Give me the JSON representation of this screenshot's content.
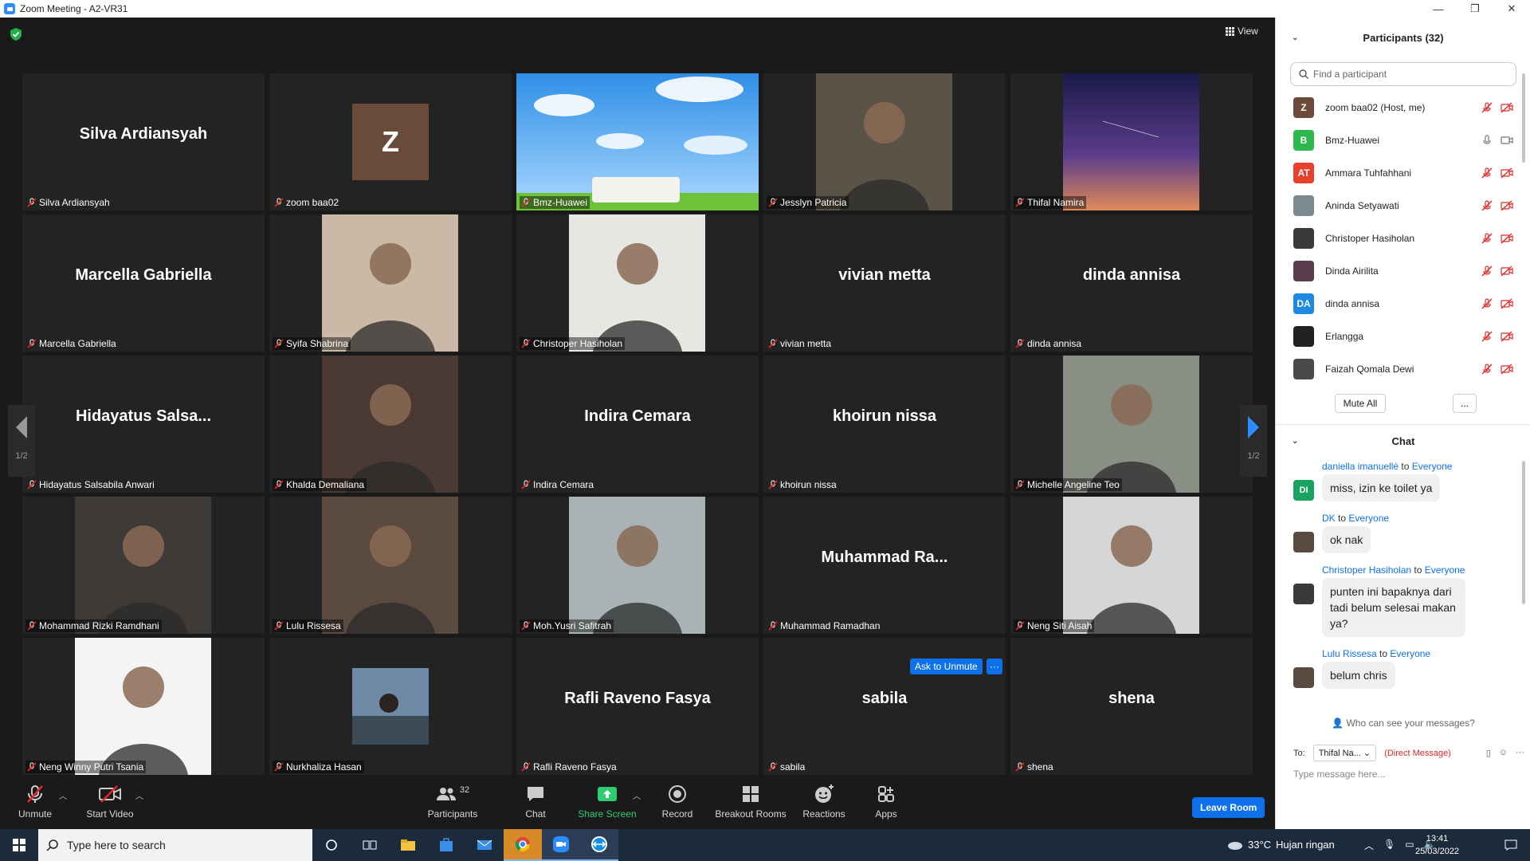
{
  "window": {
    "title": "Zoom Meeting - A2-VR31"
  },
  "view_label": "View",
  "tiles": [
    {
      "name": "Silva Ardiansyah",
      "display": "Silva Ardiansyah",
      "kind": "name"
    },
    {
      "name": "zoom baa02",
      "initial": "Z",
      "kind": "avatar"
    },
    {
      "name": "Bmz-Huawei",
      "kind": "sky"
    },
    {
      "name": "Jesslyn Patricia",
      "kind": "photo",
      "color": "#5a5448"
    },
    {
      "name": "Thifal Namira",
      "kind": "galaxy"
    },
    {
      "name": "Marcella Gabriella",
      "display": "Marcella Gabriella",
      "kind": "name"
    },
    {
      "name": "Syifa Shabrina",
      "kind": "photo",
      "color": "#c9b9a6"
    },
    {
      "name": "Christoper Hasiholan",
      "kind": "photo",
      "color": "#e6e6e2"
    },
    {
      "name": "vivian metta",
      "display": "vivian metta",
      "kind": "name"
    },
    {
      "name": "dinda annisa",
      "display": "dinda annisa",
      "kind": "name"
    },
    {
      "name": "Hidayatus Salsabila Anwari",
      "display": "Hidayatus  Salsa...",
      "kind": "name"
    },
    {
      "name": "Khalda Demaliana",
      "kind": "photo",
      "color": "#4a3a33"
    },
    {
      "name": "Indira Cemara",
      "display": "Indira Cemara",
      "kind": "name"
    },
    {
      "name": "khoirun nissa",
      "display": "khoirun nissa",
      "kind": "name"
    },
    {
      "name": "Michelle Angeline Teo",
      "kind": "photo",
      "color": "#8a8f86"
    },
    {
      "name": "Mohammad Rizki Ramdhani",
      "kind": "photo",
      "color": "#3d3a37"
    },
    {
      "name": "Lulu Rissesa",
      "kind": "photo",
      "color": "#5b4a40"
    },
    {
      "name": "Moh.Yusri Safitrah",
      "kind": "photo",
      "color": "#a9b2b4"
    },
    {
      "name": "Muhammad Ramadhan",
      "display": "Muhammad  Ra...",
      "kind": "name"
    },
    {
      "name": "Neng Siti Aisah",
      "kind": "photo",
      "color": "#d4d6d8"
    },
    {
      "name": "Neng Winny Putri Tsania",
      "kind": "photo",
      "color": "#f4f4f4"
    },
    {
      "name": "Nurkhaliza Hasan",
      "kind": "small",
      "color": "#6f8aa6"
    },
    {
      "name": "Rafli Raveno Fasya",
      "display": "Rafli Raveno Fasya",
      "kind": "name"
    },
    {
      "name": "sabila",
      "display": "sabila",
      "kind": "name"
    },
    {
      "name": "shena",
      "display": "shena",
      "kind": "name"
    }
  ],
  "pager": {
    "left": "1/2",
    "right": "1/2"
  },
  "ask_to_unmute": "Ask to Unmute",
  "more_dots": "···",
  "toolbar": {
    "unmute": "Unmute",
    "start_video": "Start Video",
    "participants": "Participants",
    "participants_count": "32",
    "chat": "Chat",
    "share_screen": "Share Screen",
    "record": "Record",
    "breakout_rooms": "Breakout Rooms",
    "reactions": "Reactions",
    "apps": "Apps",
    "leave_room": "Leave Room"
  },
  "participants_panel": {
    "title": "Participants (32)",
    "search_placeholder": "Find a participant",
    "mute_all": "Mute All",
    "more": "...",
    "list": [
      {
        "name": "zoom baa02 (Host, me)",
        "initials": "Z",
        "color": "#6a4b3a",
        "muted": true
      },
      {
        "name": "Bmz-Huawei",
        "initials": "B",
        "color": "#2db84d",
        "muted": false
      },
      {
        "name": "Ammara Tuhfahhani",
        "initials": "AT",
        "color": "#e8402c",
        "muted": true
      },
      {
        "name": "Aninda Setyawati",
        "initials": "",
        "color": "#7b8a8f",
        "muted": true
      },
      {
        "name": "Christoper Hasiholan",
        "initials": "",
        "color": "#3a3a3a",
        "muted": true
      },
      {
        "name": "Dinda Airilita",
        "initials": "",
        "color": "#5a3b4c",
        "muted": true
      },
      {
        "name": "dinda annisa",
        "initials": "DA",
        "color": "#1e88e5",
        "muted": true
      },
      {
        "name": "Erlangga",
        "initials": "",
        "color": "#222222",
        "muted": true
      },
      {
        "name": "Faizah Qomala Dewi",
        "initials": "",
        "color": "#4a4a4a",
        "muted": true
      }
    ]
  },
  "chat_panel": {
    "title": "Chat",
    "to_word": "to",
    "messages": [
      {
        "sender": "daniella imanuellè",
        "to": "Everyone",
        "text": "miss, izin ke toilet ya",
        "initials": "DI",
        "color": "#1aa260"
      },
      {
        "sender": "DK",
        "to": "Everyone",
        "text": "ok nak",
        "initials": "",
        "color": "#5b4a40"
      },
      {
        "sender": "Christoper Hasiholan",
        "to": "Everyone",
        "text": "punten ini bapaknya dari tadi belum selesai makan ya?",
        "initials": "",
        "color": "#3a3a3a"
      },
      {
        "sender": "Lulu Rissesa",
        "to": "Everyone",
        "text": "belum chris",
        "initials": "",
        "color": "#5b4a40"
      }
    ],
    "who_can_see": "Who can see your messages?",
    "to_label": "To:",
    "recipient": "Thifal Na...",
    "direct_message": "(Direct Message)",
    "input_placeholder": "Type message here..."
  },
  "taskbar": {
    "search_placeholder": "Type here to search",
    "temperature": "33°C",
    "weather": "Hujan ringan",
    "time": "13:41",
    "date": "25/03/2022"
  }
}
